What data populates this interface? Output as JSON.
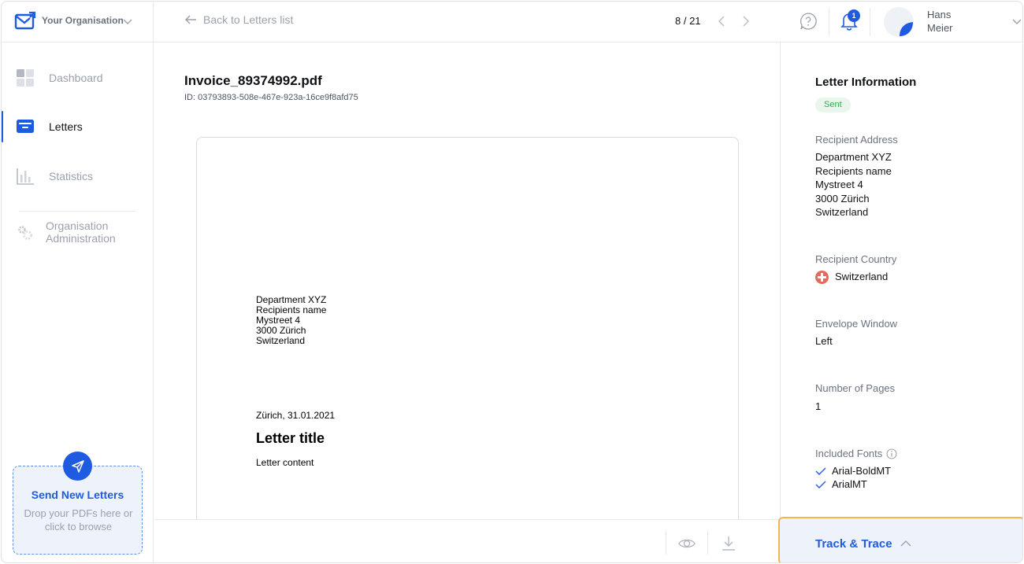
{
  "org": {
    "name": "Your Organisation"
  },
  "topbar": {
    "back_label": "Back to Letters list",
    "pager": "8 / 21",
    "notification_count": "1",
    "user_first": "Hans",
    "user_last": "Meier"
  },
  "sidebar": {
    "items": [
      {
        "label": "Dashboard",
        "icon": "dashboard-icon"
      },
      {
        "label": "Letters",
        "icon": "letters-icon",
        "active": true
      },
      {
        "label": "Statistics",
        "icon": "statistics-icon"
      }
    ],
    "admin_line1": "Organisation",
    "admin_line2": "Administration",
    "dropzone": {
      "title": "Send New Letters",
      "sub_line1": "Drop your PDFs here or",
      "sub_line2": "click to browse"
    }
  },
  "document": {
    "filename": "Invoice_89374992.pdf",
    "id": "ID: 03793893-508e-467e-923a-16ce9f8afd75",
    "address": [
      "Department XYZ",
      "Recipients name",
      "Mystreet 4",
      "3000 Zürich",
      "Switzerland"
    ],
    "date": "Zürich, 31.01.2021",
    "title": "Letter title",
    "content": "Letter content"
  },
  "info": {
    "title": "Letter Information",
    "status": "Sent",
    "recipient_address_label": "Recipient Address",
    "recipient_address": [
      "Department XYZ",
      "Recipients name",
      "Mystreet 4",
      "3000 Zürich",
      "Switzerland"
    ],
    "recipient_country_label": "Recipient Country",
    "recipient_country": "Switzerland",
    "envelope_window_label": "Envelope Window",
    "envelope_window": "Left",
    "pages_label": "Number of Pages",
    "pages": "1",
    "fonts_label": "Included Fonts",
    "fonts": [
      "Arial-BoldMT",
      "ArialMT"
    ],
    "track_label": "Track & Trace"
  },
  "colors": {
    "accent": "#1f5be0",
    "success": "#36a852",
    "highlight": "#f1b74d"
  }
}
